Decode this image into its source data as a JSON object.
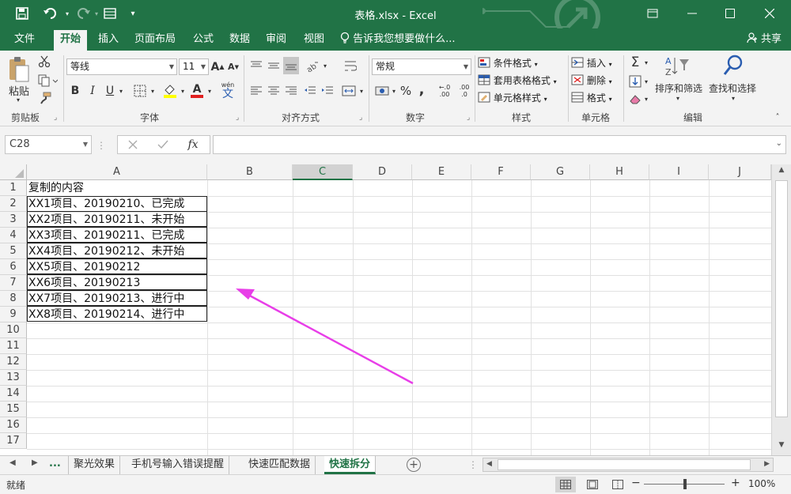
{
  "window": {
    "title": "表格.xlsx - Excel"
  },
  "quick_access": {
    "save_icon": "save-icon",
    "undo_icon": "undo-icon",
    "redo_icon": "redo-icon",
    "form_icon": "form-icon"
  },
  "menu": {
    "tabs": [
      "文件",
      "开始",
      "插入",
      "页面布局",
      "公式",
      "数据",
      "审阅",
      "视图"
    ],
    "active_tab": "开始",
    "tell_me": "告诉我您想要做什么...",
    "share": "共享"
  },
  "ribbon": {
    "clipboard": {
      "paste": "粘贴",
      "label": "剪贴板"
    },
    "font": {
      "name": "等线",
      "size": "11",
      "bold": "B",
      "italic": "I",
      "underline": "U",
      "wen": "wén",
      "wen_char": "文",
      "label": "字体"
    },
    "alignment": {
      "label": "对齐方式"
    },
    "number": {
      "format": "常规",
      "percent": "%",
      "comma": ",",
      "inc": ".00",
      "dec": ".0",
      "label": "数字"
    },
    "styles": {
      "conditional": "条件格式",
      "table": "套用表格格式",
      "cell": "单元格样式",
      "label": "样式"
    },
    "cells": {
      "insert": "插入",
      "delete": "删除",
      "format": "格式",
      "label": "单元格"
    },
    "editing": {
      "sum": "Σ",
      "sort": "排序和筛选",
      "find": "查找和选择",
      "label": "编辑"
    }
  },
  "formula_bar": {
    "name_box": "C28",
    "fx": "fx",
    "value": ""
  },
  "sheet": {
    "columns": [
      "A",
      "B",
      "C",
      "D",
      "E",
      "F",
      "G",
      "H",
      "I",
      "J"
    ],
    "rows": [
      "1",
      "2",
      "3",
      "4",
      "5",
      "6",
      "7",
      "8",
      "9",
      "10",
      "11",
      "12",
      "13",
      "14",
      "15",
      "16",
      "17"
    ],
    "cells": [
      "复制的内容",
      "XX1项目、20190210、已完成",
      "XX2项目、20190211、未开始",
      "XX3项目、20190211、已完成",
      "XX4项目、20190212、未开始",
      "XX5项目、20190212",
      "XX6项目、20190213",
      "XX7项目、20190213、进行中",
      "XX8项目、20190214、进行中"
    ],
    "selected_column": "C",
    "annotation_color": "#e83ee8"
  },
  "sheet_tabs": {
    "ellipsis": "...",
    "tabs": [
      "聚光效果",
      "手机号输入错误提醒",
      "快速匹配数据",
      "快速拆分"
    ],
    "active": "快速拆分",
    "add": "+"
  },
  "status": {
    "ready": "就绪",
    "zoom": "100%",
    "minus": "−",
    "plus": "+"
  },
  "colors": {
    "accent": "#217346"
  }
}
